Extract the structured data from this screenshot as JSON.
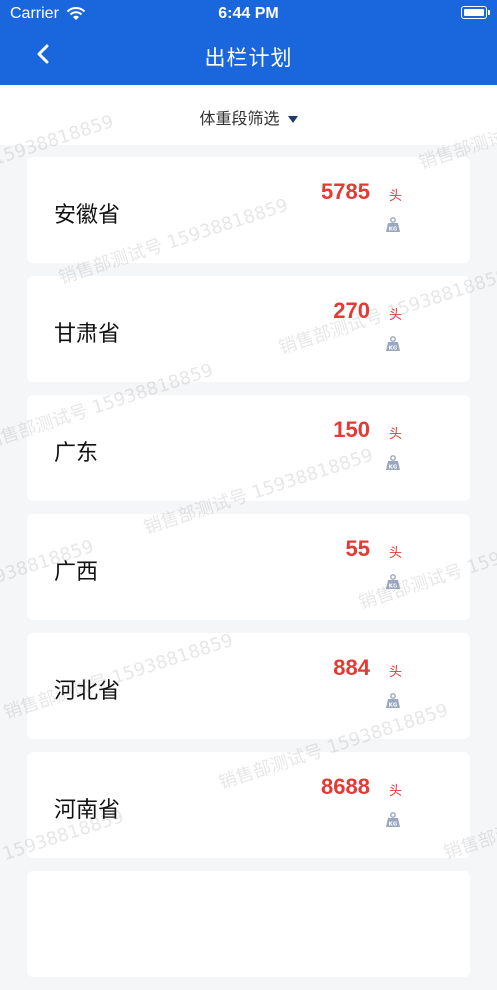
{
  "status_bar": {
    "carrier": "Carrier",
    "time": "6:44 PM"
  },
  "header": {
    "title": "出栏计划"
  },
  "filter": {
    "label": "体重段筛选"
  },
  "provinces": [
    {
      "name": "安徽省",
      "count": "5785",
      "unit": "头"
    },
    {
      "name": "甘肃省",
      "count": "270",
      "unit": "头"
    },
    {
      "name": "广东",
      "count": "150",
      "unit": "头"
    },
    {
      "name": "广西",
      "count": "55",
      "unit": "头"
    },
    {
      "name": "河北省",
      "count": "884",
      "unit": "头"
    },
    {
      "name": "河南省",
      "count": "8688",
      "unit": "头"
    }
  ],
  "watermark": {
    "text": "销售部测试号 15938818859",
    "number": "15938818859"
  }
}
